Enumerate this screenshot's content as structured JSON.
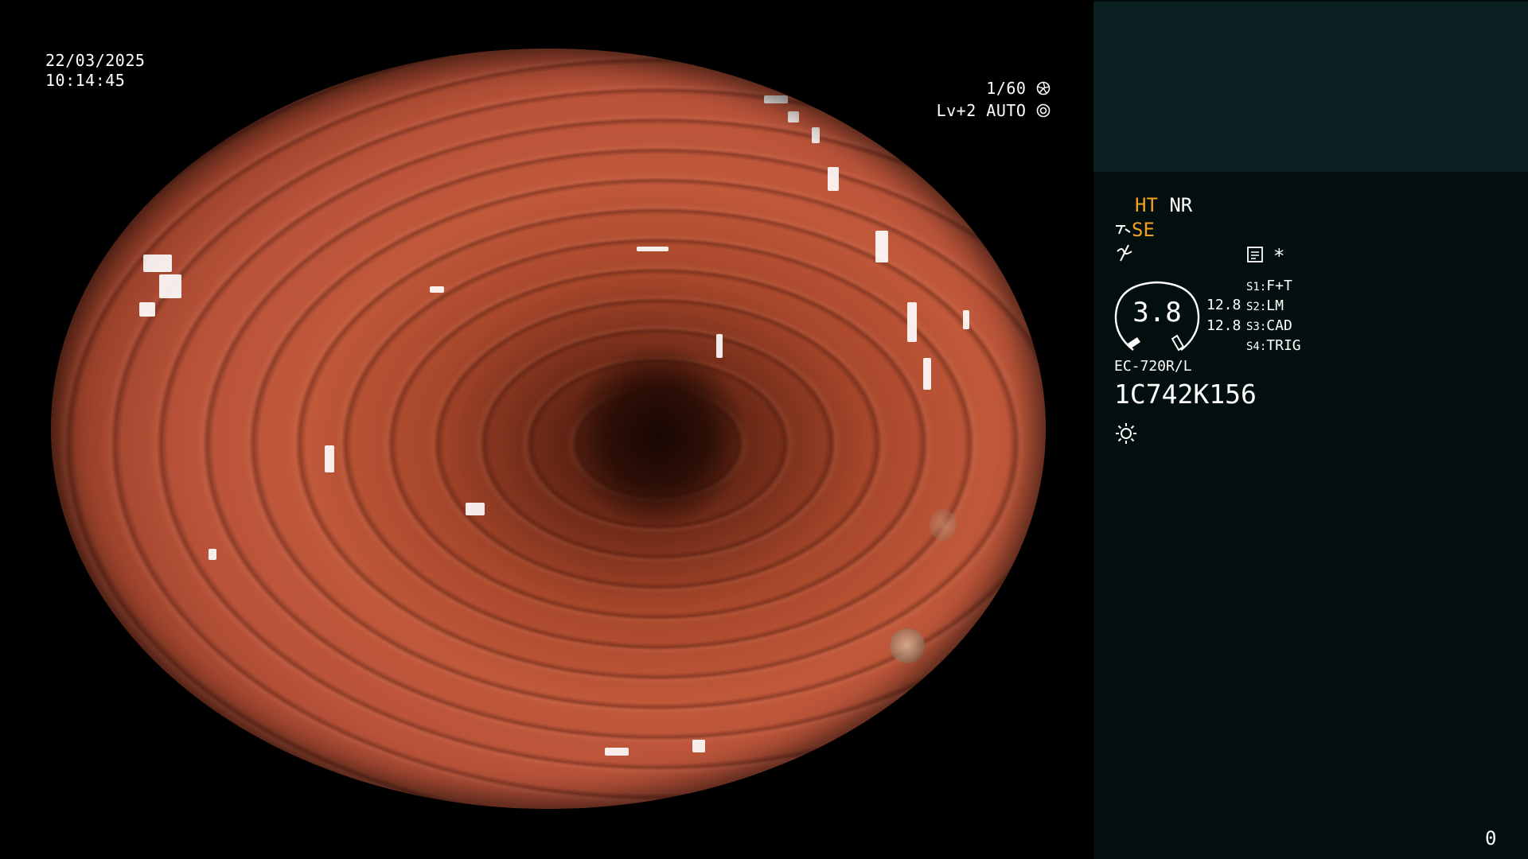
{
  "overlay": {
    "date": "22/03/2025",
    "time": "10:14:45",
    "shutter": "1/60",
    "iris": "Lv+2 AUTO"
  },
  "panel": {
    "ht": "HT",
    "nr": "NR",
    "se": "SE",
    "gauge_value": "3.8",
    "gauge_right_top": "12.8",
    "gauge_right_bottom": "12.8",
    "star": "*",
    "switches": [
      {
        "id": "S1",
        "label": "F+T"
      },
      {
        "id": "S2",
        "label": "LM"
      },
      {
        "id": "S3",
        "label": "CAD"
      },
      {
        "id": "S4",
        "label": "TRIG"
      }
    ],
    "scope_model": "EC-720R/L",
    "serial": "1C742K156"
  },
  "page_number": "0",
  "icons": {
    "shutter": "aperture-icon",
    "iris": "iris-icon",
    "water": "water-jet-icon",
    "filter": "filter-icon",
    "record": "record-icon",
    "light": "sun-icon"
  },
  "colors": {
    "accent_orange": "#f3a01e",
    "panel_bg": "#030f0e",
    "panel_top_bg": "#0b2121"
  }
}
